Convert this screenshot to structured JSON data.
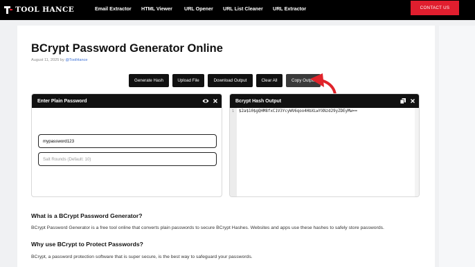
{
  "header": {
    "logo_text": "Tool Hance",
    "nav": [
      "Email Extractor",
      "HTML Viewer",
      "URL Opener",
      "URL List Cleaner",
      "URL Extractor"
    ],
    "contact_label": "CONTACT US"
  },
  "article": {
    "title": "BCrypt Password Generator Online",
    "date": "August 11, 2025",
    "by": "by",
    "author": "@ToolHance"
  },
  "toolbar": {
    "generate": "Generate Hash",
    "upload": "Upload File",
    "download": "Download Output",
    "clear": "Clear All",
    "copy": "Copy Output"
  },
  "input_panel": {
    "title": "Enter Plain Password",
    "password_value": "mypassword123",
    "salt_placeholder": "Salt Rounds (Default: 10)"
  },
  "output_panel": {
    "title": "Bcrypt Hash Output",
    "line_number": "1",
    "hash": "$2a$10$gQHM8fxC1V3YcyWV6qoo4HbXLwYXNzd29yZDEyMw=="
  },
  "content": {
    "h1": "What is a BCrypt Password Generator?",
    "p1": "BCrypt Password Generator is a free tool online that converts plain passwords to secure BCrypt Hashes. Websites and apps use these hashes to safely store passwords.",
    "h2": "Why use BCrypt to Protect Passwords?",
    "p2": "BCrypt, a password protection software that is super secure, is the best way to safeguard your passwords."
  },
  "colors": {
    "nav_bg": "#000000",
    "contact_bg": "#e01e2e",
    "annotation_arrow": "#e0242b",
    "button_bg": "#111111"
  }
}
